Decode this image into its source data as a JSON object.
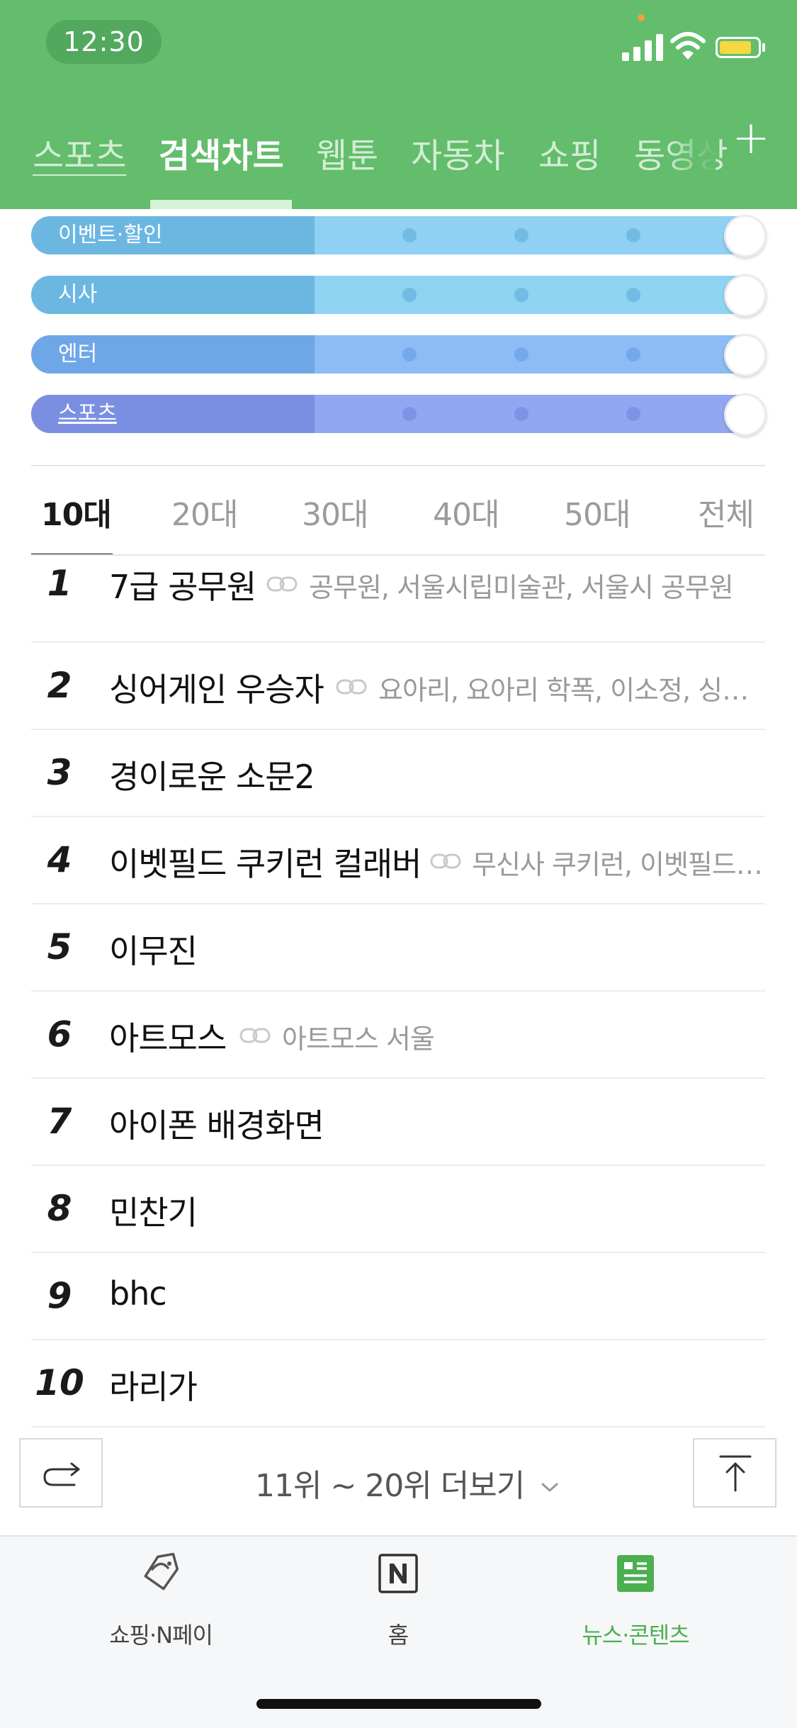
{
  "status_bar": {
    "time": "12:30"
  },
  "header": {
    "tabs": [
      {
        "label": "스포츠"
      },
      {
        "label": "검색차트"
      },
      {
        "label": "웹툰"
      },
      {
        "label": "자동차"
      },
      {
        "label": "쇼핑"
      },
      {
        "label": "동영상"
      }
    ],
    "active_tab": "검색차트",
    "add_icon": "plus-icon"
  },
  "filters": {
    "sliders": [
      {
        "label": "이벤트·할인",
        "level": 1.0,
        "color_left": "#6cb7e2",
        "color_right": "#8fd0f3"
      },
      {
        "label": "시사",
        "level": 1.0,
        "color_left": "#6cb7e2",
        "color_right": "#8fd3f3"
      },
      {
        "label": "엔터",
        "level": 1.0,
        "color_left": "#6fa6e8",
        "color_right": "#8cbcf3"
      },
      {
        "label": "스포츠",
        "level": 1.0,
        "color_left": "#7b8fe2",
        "color_right": "#93a6f1"
      }
    ]
  },
  "age_tabs": {
    "items": [
      {
        "label": "10대"
      },
      {
        "label": "20대"
      },
      {
        "label": "30대"
      },
      {
        "label": "40대"
      },
      {
        "label": "50대"
      },
      {
        "label": "전체"
      }
    ],
    "active": "10대"
  },
  "ranking": [
    {
      "rank": "1",
      "term": "7급 공무원",
      "related": "공무원, 서울시립미술관, 서울시 공무원"
    },
    {
      "rank": "2",
      "term": "싱어게인 우승자",
      "related": "요아리, 요아리 학폭, 이소정, 싱어게인"
    },
    {
      "rank": "3",
      "term": "경이로운 소문2",
      "related": ""
    },
    {
      "rank": "4",
      "term": "이벳필드 쿠키런 컬래버",
      "related": "무신사 쿠키런, 이벳필드 쿠키런"
    },
    {
      "rank": "5",
      "term": "이무진",
      "related": ""
    },
    {
      "rank": "6",
      "term": "아트모스",
      "related": "아트모스 서울"
    },
    {
      "rank": "7",
      "term": "아이폰 배경화면",
      "related": ""
    },
    {
      "rank": "8",
      "term": "민찬기",
      "related": ""
    },
    {
      "rank": "9",
      "term": "bhc",
      "related": ""
    },
    {
      "rank": "10",
      "term": "라리가",
      "related": ""
    }
  ],
  "more": {
    "label": "11위 ~ 20위 더보기",
    "share_icon": "share-icon",
    "top_icon": "scroll-top-icon"
  },
  "bottom_nav": {
    "items": [
      {
        "label": "쇼핑·N페이",
        "icon": "shopping-tag-icon"
      },
      {
        "label": "홈",
        "icon": "naver-n-icon"
      },
      {
        "label": "뉴스·콘텐츠",
        "icon": "news-icon"
      }
    ],
    "active": "뉴스·콘텐츠",
    "active_color": "#4caf50"
  }
}
